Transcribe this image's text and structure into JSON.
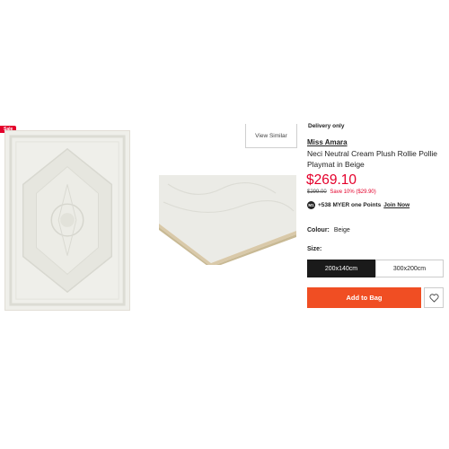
{
  "gallery": {
    "badge": "Sale",
    "view_similar": "View Similar"
  },
  "product": {
    "delivery": "Delivery only",
    "brand": "Miss Amara",
    "title": "Neci Neutral Cream Plush Rollie Pollie Playmat in Beige",
    "price": "$269.10",
    "was_price": "$299.00",
    "save_text": "Save 10% ($29.90)",
    "points_icon": "M1",
    "points_prefix": "+538 MYER one Points",
    "points_link": "Join Now",
    "colour_label": "Colour:",
    "colour_value": "Beige",
    "size_label": "Size:",
    "sizes": [
      "200x140cm",
      "300x200cm"
    ],
    "selected_size": "200x140cm",
    "add_to_bag": "Add to Bag",
    "wishlist_icon": "heart-icon"
  },
  "colors": {
    "sale_red": "#e4002b",
    "cta_orange": "#f04e23",
    "selected_size_bg": "#1a1a1a",
    "rug_cream": "#eeeee9"
  }
}
